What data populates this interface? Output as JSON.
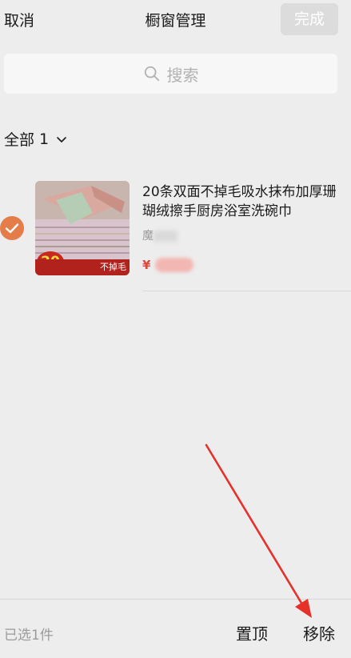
{
  "header": {
    "cancel_label": "取消",
    "title": "橱窗管理",
    "done_label": "完成"
  },
  "search": {
    "placeholder": "搜索",
    "icon": "search-icon"
  },
  "filter": {
    "label": "全部",
    "count": "1",
    "icon": "chevron-down-icon"
  },
  "product": {
    "selected": true,
    "title": "20条双面不掉毛吸水抹布加厚珊瑚绒擦手厨房浴室洗碗巾",
    "shop_visible": "魔",
    "price_symbol": "¥",
    "thumb_badge": "20",
    "thumb_strip": "不掉毛"
  },
  "footer": {
    "selected_count": "已选1件",
    "pin_label": "置顶",
    "remove_label": "移除"
  },
  "colors": {
    "accent": "#e57d4a",
    "price": "#e0463b",
    "annotation_arrow": "#e6312a"
  }
}
